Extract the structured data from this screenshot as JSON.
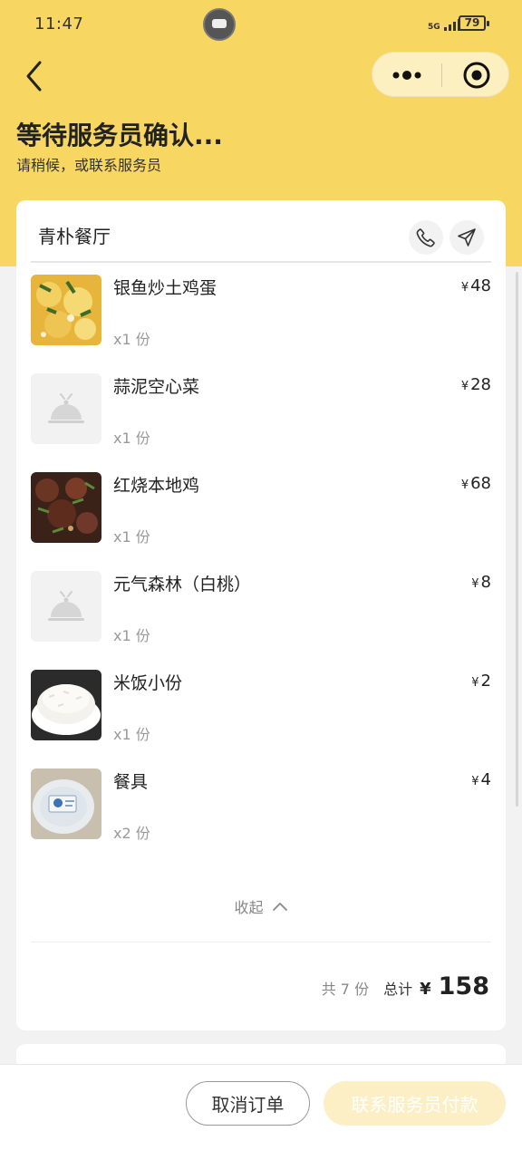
{
  "status_bar": {
    "time": "11:47",
    "network": "5G",
    "battery": "79"
  },
  "header": {
    "title": "等待服务员确认...",
    "subtitle": "请稍候，或联系服务员"
  },
  "restaurant": {
    "name": "青朴餐厅"
  },
  "items": [
    {
      "name": "银鱼炒土鸡蛋",
      "qty": "x1 份",
      "price": "48",
      "image": "egg-dish"
    },
    {
      "name": "蒜泥空心菜",
      "qty": "x1 份",
      "price": "28",
      "image": "placeholder"
    },
    {
      "name": "红烧本地鸡",
      "qty": "x1 份",
      "price": "68",
      "image": "chicken-dish"
    },
    {
      "name": "元气森林（白桃）",
      "qty": "x1 份",
      "price": "8",
      "image": "placeholder"
    },
    {
      "name": "米饭小份",
      "qty": "x1 份",
      "price": "2",
      "image": "rice"
    },
    {
      "name": "餐具",
      "qty": "x2 份",
      "price": "4",
      "image": "tableware"
    }
  ],
  "currency": "¥",
  "collapse_label": "收起",
  "summary": {
    "count": "共 7 份",
    "total_label": "总计",
    "amount": "158"
  },
  "actions": {
    "cancel": "取消订单",
    "pay": "联系服务员付款"
  },
  "colors": {
    "accent": "#f8d662",
    "pay_disabled": "#fcefc6"
  }
}
